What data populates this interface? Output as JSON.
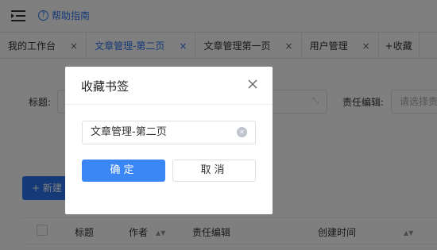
{
  "header": {
    "menu_icon": "menu-fold-icon",
    "help_label": "帮助指南",
    "help_icon": "question-circle-icon",
    "accent": "#2d74f0"
  },
  "tabs": [
    {
      "label": "我的工作台",
      "close": "×"
    },
    {
      "label": "文章管理-第二页",
      "close": "×",
      "active": true
    },
    {
      "label": "文章管理第一页",
      "close": "×"
    },
    {
      "label": "用户管理",
      "close": "×"
    },
    {
      "label": "+收藏"
    }
  ],
  "filters": {
    "title_label": "标题:",
    "editor_label": "责任编辑:",
    "editor_placeholder": "请选择责"
  },
  "toolbar": {
    "new_label": "+ 新建"
  },
  "table": {
    "columns": [
      "标题",
      "作者",
      "责任编辑",
      "创建时间"
    ]
  },
  "dialog": {
    "title": "收藏书签",
    "input_value": "文章管理-第二页",
    "confirm_label": "确定",
    "cancel_label": "取消",
    "primary_color": "#3b86f5"
  }
}
